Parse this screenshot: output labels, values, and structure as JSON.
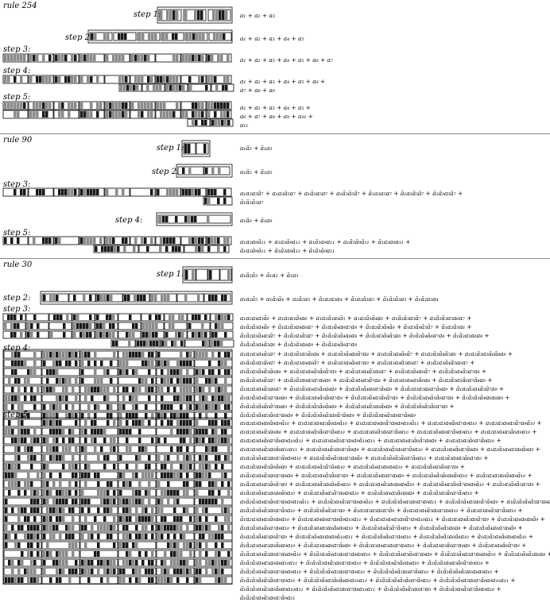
{
  "sections": [
    {
      "title": "rule 254",
      "steps": [
        {
          "label": "step 1:",
          "formula": [
            "a₁ + a₂ + a₃"
          ]
        },
        {
          "label": "step 2:",
          "formula": [
            "a₁ + a₂ + a₃ + a₄ + a₅"
          ]
        },
        {
          "label": "step 3:",
          "formula": [
            "a₁ + a₂ + a₃ + a₄ + a₅ + a₆ + a₇"
          ]
        },
        {
          "label": "step 4:",
          "formula": [
            "a₁ + a₂ + a₃ + a₄ + a₅ + a₆ +",
            "a₇ + a₈ + a₉"
          ]
        },
        {
          "label": "step 5:",
          "formula": [
            "a₁ + a₂ + a₃ + a₄ + a₅ +",
            "a₆ + a₇ + a₈ + a₉ + a₁₀ +",
            "a₁₁"
          ]
        }
      ]
    },
    {
      "title": "rule 90",
      "steps": [
        {
          "label": "step 1:",
          "formula": [
            "a₁ā₃ + ā₁a₃"
          ]
        },
        {
          "label": "step 2:",
          "formula": [
            "a₁ā₅ + ā₁a₅"
          ]
        },
        {
          "label": "step 3:",
          "formula": [
            "a₁a₃a₅ā₇ + a₁a₃ā₅a₇ + a₁ā₃a₅a₇ + a₁ā₃ā₅ā₇ + ā₁a₃a₅a₇ + ā₁a₃ā₅ā₇ + ā₁ā₃a₅ā₇ +",
            "ā₁ā₃ā₅a₇"
          ]
        },
        {
          "label": "step 4:",
          "formula": [
            "a₁ā₉ + ā₁a₉"
          ]
        },
        {
          "label": "step 5:",
          "formula": [
            "a₁a₃a₉ā₁₁ + a₁a₃ā₉a₁₁ + a₁ā₃a₉a₁₁ + a₁ā₃ā₉ā₁₁ + ā₁a₃a₉a₁₁ +",
            "ā₁a₃ā₉ā₁₁ + ā₁ā₃a₉ā₁₁ + ā₁ā₃ā₉a₁₁"
          ]
        }
      ]
    },
    {
      "title": "rule 30",
      "steps": [
        {
          "label": "step 1:",
          "formula": [
            "a₁ā₂ā₃ + ā₁a₂ + ā₁a₃"
          ]
        },
        {
          "label": "step 2:",
          "formula": [
            "a₁a₂ā₅ + a₁ā₃ā₄ + a₁ā₂a₅ + ā₁a₂a₃a₄ + ā₁a₂ā₃a₅ + ā₁ā₂ā₃a₅ + ā₁ā₂a₃a₄"
          ]
        },
        {
          "label": "step 3:",
          "formula": [
            "a₁a₂a₄a₅ā₆ + a₁a₂a₃ā₄a₆ + a₁a₂ā₃a₄ā₅ + a₁a₂ā₃ā₄a₆ + a₁ā₂ā₃a₅ā₇ + a₁ā₂ā₃a₅a₆a₇ +",
            "a₁ā₂ā₃a₄ā₆ + ā₁a₂ā₃a₄a₆a₇ + ā₁a₂ā₄a₆a₇a₈ + ā₁a₂ā₃ā₄ā₆ + ā₁a₃ā₄ā₅ā₇ + ā₁a₂ā₃a₆ +",
            "ā₁ā₂a₃ā₄a₅ā₇ + ā₁ā₂a₃ā₅a₇ + ā₁ā₂ā₃ā₄a₆a₈ + ā₁ā₂a₃ā₄ā₅a₆ + ā₁ā₂ā₄ā₆a₇a₈ + ā₁ā₂a₃a₆a₈ +",
            "ā₁ā₂ā₃a₄ā₅a₆ + ā₁ā₂ā₃a₈a₉ + ā₁ā₂a₄ā₆a₇a₉"
          ]
        },
        {
          "label": "step 4:",
          "formula": [
            "a₁a₂a₃a₄ā₅a₇ + a₁a₂ā₃a₅ā₆a₈ + a₁a₂ā₃ā₄a₆ā₇a₈ + a₁a₂ā₃a₄ā₆ā₇ + a₁a₂ā₃ā₄ā₅a₆ + a₁a₂ā₃a₅ā₆ā₈a₉ +",
            "a₁ā₂ā₃a₅ā₆a₇ + a₁ā₂a₃a₄a₆ā₇ + a₁ā₂a₃a₄ā₆a₇a₉ + a₁ā₂a₃a₄ā₅a₆a₇ + a₁ā₂a₃ā₄ā₅a₆a₇ +",
            "a₁ā₂a₃ā₄ā₅ā₆a₈ + a₁ā₂a₃a₄ā₅ā₆ā₇a₉ + a₁ā₂a₃a₄ā₅a₆a₇ + a₁ā₂a₃ā₄a₆ā₇ + a₁ā₂ā₃a₄ā₅a₇a₈ +",
            "a₁ā₂ā₃a₄ā₅a₇ + a₁ā₂ā₃a₄a₅a₇a₈a₉ + a₁ā₂ā₃a₄a₅ā₇a₈ + ā₁a₂a₃a₄a₅ā₆a₈ + ā₁a₂ā₃a₅ā₆a₇ā₈a₉ +",
            "ā₁a₂a₃a₄ā₅a₆a₇ + ā₁a₂ā₃a₄a₅ā₆a₈a₉ + ā₁a₂ā₃ā₄a₆a₇ā₈a₉ + ā₁ā₂a₃a₅a₆a₇ā₈a₉ + ā₁a₂ā₃a₄ā₅ā₇a₉ +",
            "ā₁a₂ā₃a₄ā₅a₇a₈a₉ + ā₁ā₂a₃a₄ā₅ā₆a₇a₈ + ā₁ā₂a₃ā₄a₅ā₆ā₇a₉ + ā₁ā₂ā₃a₄ā₅ā₆a₇a₈ + ā₁ā₂ā₃ā₄a₆a₈a₉ +",
            "ā₁ā₂ā₃ā₄ā₆ā₇a₈a₉ + ā₁ā₂ā₃ā₅ā₆ā₈a₉ + ā₁ā₂ā₃a₄ā₅a₆ā₈a₉ + ā₁ā₂ā₃ā₄ā₅ā₆a₇a₉ +",
            "ā₁ā₂ā₃ā₄a₅ā₆a₇a₈a₉ + ā₁ā₂ā₃ā₄ā₅a₆ā₇ā₈a₉ + ā₁ā₂ā₃a₄ā₅a₆a₇ā₈a₉"
          ]
        },
        {
          "label": "step 5:",
          "formula": [
            "a₁a₂a₃a₄a₆ā₈a₉ā₁₀ + a₁a₂a₃a₄a₅ā₆a₈ā₁₀ + a₁a₂a₃a₄a₆ā₇a₈a₉a₁₀ā₁₁ + a₁a₂a₃a₄ā₆a₇a₉a₁₀ + a₁a₂a₃a₄a₅ā₇a₉ā₁₀ +",
            "a₁a₂a₃a₄ā₅a₆a₈ + a₁a₂a₃a₄ā₅ā₆a₇ā₈a₁₀ + a₁a₂a₃a₄ā₅a₆a₇ā₈a₁₀ + a₁a₂a₃ā₄a₆a₇ā₈a₉a₁₀ + a₁a₂a₃a₄a₅ā₆a₉a₁₀ +",
            "a₁a₂a₃a₄ā₆a₇ā₈a₉a₁₀ā₁₁ + a₁a₂a₃a₄ā₅a₇a₈a₉ā₁₀a₁₁ + a₁a₂a₃a₄a₅ā₆ā₇a₈a₉ + a₁a₂a₃a₅ā₆a₇ā₈a₁₀ +",
            "a₁a₂a₃a₄ā₅a₆ā₈a₁₀a₁₁ + a₁a₂ā₃a₄ā₅a₆a₇ā₈a₉ + a₁a₂ā₃a₄ā₅a₆a₇ā₈a₁₀ + a₁a₂ā₃a₄ā₆a₇ā₈a₉ + a₁a₂ā₃a₄a₅a₆ā₈a₉ +",
            "a₁a₂ā₃ā₄a₅a₆a₇ā₈a₉a₁₀ + a₁a₂ā₃ā₄ā₅a₆a₇a₈ā₉ + a₁a₂ā₃ā₄ā₅ā₆a₇ā₈a₁₀ + a₁a₂ā₃a₄a₅ā₆a₇a₉ +",
            "a₁a₂ā₃a₄ā₅ā₆ā₈a₉ + a₁a₂ā₃a₄ā₅ā₇ā₈a₁₀ + a₁a₂ā₃ā₄a₅a₆a₈a₁₀ + a₁a₂ā₃ā₄a₅ā₆a₇a₈ +",
            "a₁ā₂a₃a₄ā₅a₆a₇a₈a₉ + a₁ā₂a₃a₄ā₅ā₆a₇a₉ + a₁ā₂a₃ā₄a₆a₇a₈a₉ + a₁ā₂a₃ā₄ā₅ā₆a₈ā₉a₁₀ + a₁ā₂a₃a₅a₆ā₈a₉ā₁₀ +",
            "a₁ā₂a₃a₄a₅ā₆ā₇a₉ + a₁ā₂a₃a₄ā₅a₆ā₈ā₉a₁₀ + a₁ā₂a₃a₄ā₅a₆a₈a₉ā₁₀ + a₁ā₂a₃ā₄a₅ā₆ā₇a₈a₉ā₁₀ + a₁ā₂a₃ā₄ā₅a₇a₉ +",
            "a₁ā₂a₃ā₄a₅a₆a₈ā₉a₁₀ + a₁ā₂a₃ā₄a₅ā₇a₈a₉a₁₀ + a₁ā₂ā₃a₄a₅ā₆a₈a₉ + a₁ā₂ā₃a₅ā₆a₇ā₉a₁₀ +",
            "a₁ā₂ā₃a₄a₅ā₆a₇a₈a₉a₁₀ā₁₁ + a₁ā₂ā₃a₄ā₅a₇a₈a₉ā₁₀ + a₁ā₂ā₃ā₄a₅a₆a₇a₉a₁₁ + a₁ā₂ā₃ā₄a₅a₆ā₇ā₈a₉ + a₁ā₂ā₃ā₄ā₅a₇a₈a₉a₁₀a₁₁ +",
            "a₁ā₂ā₃ā₄ā₅a₆a₇ā₉a₁₀ + a₁ā₂ā₃ā₄ā₅a₇a₉ + ā₁a₂a₃a₅a₆a₇ā₉ + ā₁a₂a₃a₄ā₅a₆a₇a₈a₁₀ + ā₁a₂a₃a₄ā₅a₇ā₈a₁₀ +",
            "ā₁a₂a₃a₄a₅ā₆a₈a₁₀ + ā₁a₂a₃a₄a₆a₇a₈ā₉a₁₀a₁₁ + ā₁a₂a₃a₄a₅a₆ā₇a₉a₁₀a₁₁ + ā₁a₂a₃a₄ā₅a₆ā₇a₉ + ā₁a₂ā₃a₄a₆a₈ā₉ +",
            "ā₁a₂ā₃a₄ā₆a₇a₈a₁₀ + ā₁a₂ā₃a₄a₅a₆ā₈a₉a₁₀ + ā₁a₂ā₃a₄ā₅ā₇ā₉a₁₀ + ā₁a₂ā₃ā₄ā₅a₆a₈ + ā₁a₂ā₃ā₄a₆a₇a₈ā₉ +",
            "ā₁a₂ā₃ā₄a₅a₆ā₇a₉ + ā₁a₂ā₃ā₄a₆a₈a₉ā₁₀a₁₁ + ā₁a₂ā₃ā₄ā₆a₇a₈a₁₀ + ā₁a₂ā₃ā₄ā₅a₆ā₈a₁₀ + ā₁a₂ā₃a₄ā₆a₈a₉ā₁₀ +",
            "ā₁ā₂a₃a₄a₅a₆ā₈a₉a₁₀ + ā₁ā₂a₃a₄a₆a₇ā₈a₉ + ā₁ā₂a₃a₄a₅a₆a₇a₈a₁₀ + ā₁ā₂a₃a₅ā₆a₇a₈a₉ + ā₁ā₂a₃a₄ā₆ā₇a₉ +",
            "ā₁ā₂a₃a₄ā₅a₆a₇a₈a₉ā₁₀ + ā₁ā₂a₃ā₄a₅a₆a₇a₈a₉a₁₀ + ā₁ā₂a₃ā₄a₅ā₆a₇a₈a₉ + ā₁ā₂a₃ā₄a₅a₇a₈a₉ā₁₀ + ā₁ā₂a₃ā₄ā₅a₆a₈ +",
            "ā₁ā₂ā₃a₄a₅a₆a₈a₁₀a₁₁ + ā₁ā₂ā₃a₄ā₅a₆a₇a₉a₁₀ + ā₁ā₂ā₃a₄ā₅ā₆a₈a₁₀ + ā₁ā₂ā₃a₄a₅ā₆ā₇a₉a₁₀ +",
            "ā₁ā₂ā₃a₄ā₅a₆a₇a₈a₉a₁₀ + ā₁ā₂ā₃ā₄a₅a₆a₇a₉a₁₀ + ā₁ā₂ā₃ā₄ā₅a₆a₇ā₈a₁₀ + ā₁ā₂ā₃ā₄ā₅a₆a₈a₉a₁₀ +",
            "ā₁ā₂ā₃ā₄ā₅ā₆a₇a₉a₁₀ + ā₁ā₂ā₃ā₄a₅ā₆ā₈a₉a₁₀a₁₁ + ā₁ā₂ā₃ā₄ā₅ā₆a₇ā₉a₁₀ + ā₁ā₂ā₃ā₄a₅a₆a₇ā₈a₉a₁₀a₁₁ +",
            "ā₁ā₂ā₃a₄ā₅a₆ā₈a₉a₁₀a₁₁ + ā₁ā₂ā₃ā₄a₅a₆a₇a₈a₁₀a₁₁ + ā₁ā₂ā₃ā₄ā₅a₆a₇a₉ + ā₁ā₂ā₃a₄ā₅a₇ā₈a₉a₁₀ +",
            "ā₁ā₂ā₃a₄ā₅a₆a₇ā₉a₁₁"
          ]
        }
      ]
    }
  ],
  "colors": {
    "cell_dark": "#1a1a1a",
    "cell_gray": "#8a8a8a",
    "cell_white": "#ffffff",
    "border": "#000000",
    "separator": "#888888"
  }
}
